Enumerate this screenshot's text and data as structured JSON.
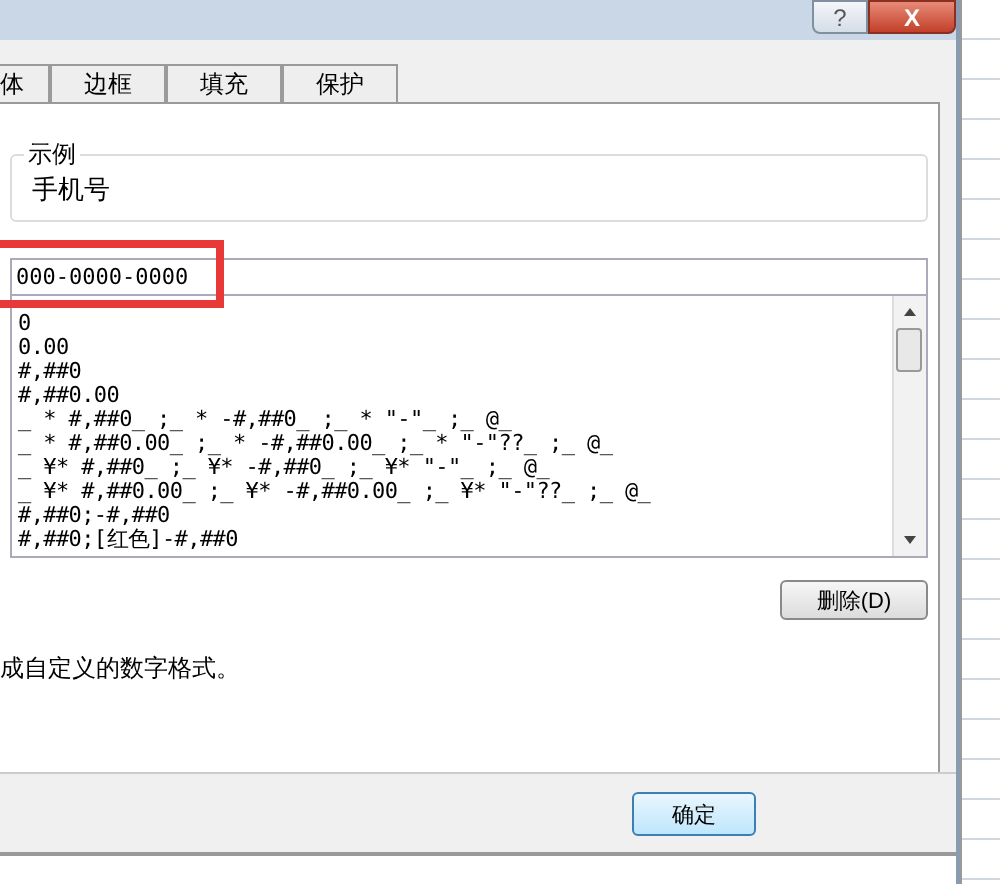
{
  "window": {
    "help_button": "?",
    "close_button": "X"
  },
  "tabs": [
    {
      "label": "体",
      "selected": false
    },
    {
      "label": "边框",
      "selected": false
    },
    {
      "label": "填充",
      "selected": false
    },
    {
      "label": "保护",
      "selected": false
    }
  ],
  "sample": {
    "legend": "示例",
    "value": "手机号"
  },
  "type_field": {
    "value": "000-0000-0000",
    "highlighted": true
  },
  "formats": [
    {
      "label": "0",
      "selected": false
    },
    {
      "label": "0.00",
      "selected": false
    },
    {
      "label": "#,##0",
      "selected": false
    },
    {
      "label": "#,##0.00",
      "selected": false
    },
    {
      "label": "_ * #,##0_ ;_ * -#,##0_ ;_ * \"-\"_ ;_ @_",
      "selected": false
    },
    {
      "label": "_ * #,##0.00_ ;_ * -#,##0.00_ ;_ * \"-\"??_ ;_ @_",
      "selected": false
    },
    {
      "label": "_ ¥* #,##0_ ;_ ¥* -#,##0_ ;_ ¥* \"-\"_ ;_ @_",
      "selected": false
    },
    {
      "label": "_ ¥* #,##0.00_ ;_ ¥* -#,##0.00_ ;_ ¥* \"-\"??_ ;_ @_",
      "selected": false
    },
    {
      "label": "#,##0;-#,##0",
      "selected": false
    },
    {
      "label": "#,##0;[红色]-#,##0",
      "selected": false
    }
  ],
  "delete_button": "删除(D)",
  "description": "成自定义的数字格式。",
  "ok_button": "确定"
}
